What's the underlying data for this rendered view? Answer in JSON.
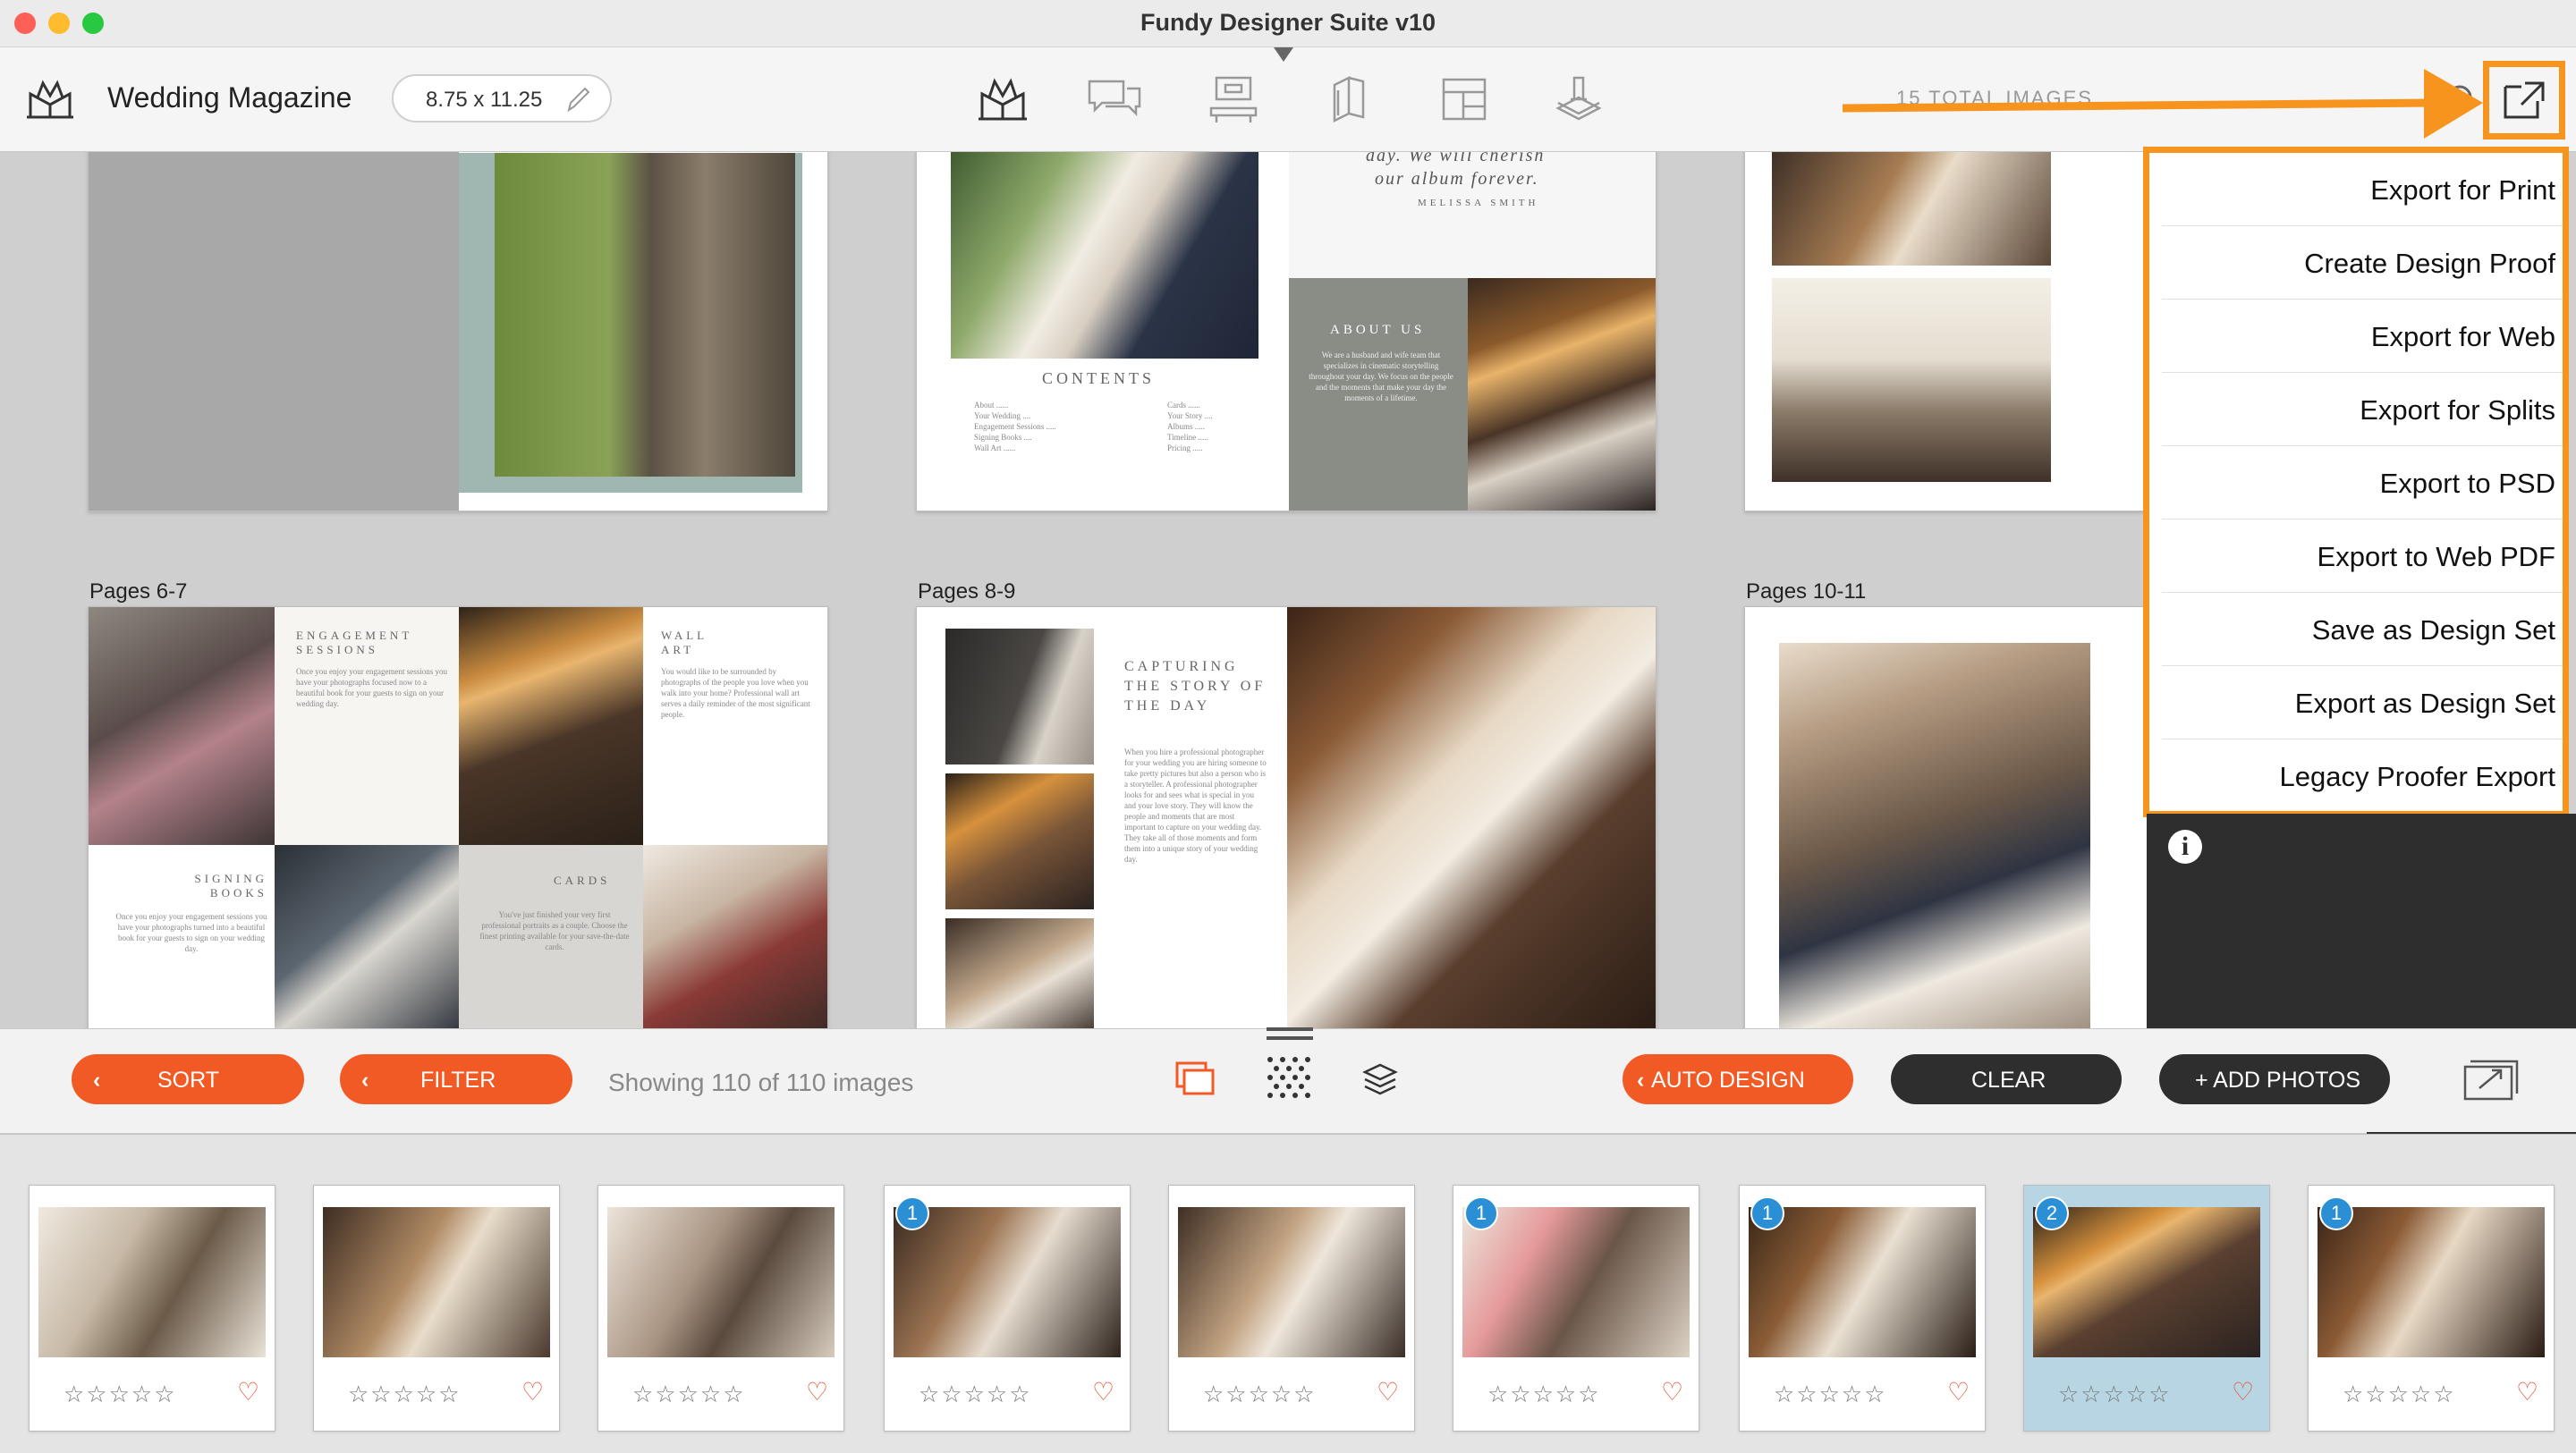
{
  "window": {
    "title": "Fundy Designer Suite v10"
  },
  "toolbar": {
    "project_name": "Wedding Magazine",
    "page_size": "8.75 x 11.25",
    "total_images": "15 TOTAL IMAGES",
    "tools": [
      "album-design-icon",
      "proof-chat-icon",
      "wall-art-icon",
      "cards-icon",
      "layout-icon",
      "print-stack-icon"
    ]
  },
  "spreads": [
    {
      "label": ""
    },
    {
      "label": ""
    },
    {
      "label": ""
    },
    {
      "label": "Pages 6-7"
    },
    {
      "label": "Pages 8-9"
    },
    {
      "label": "Pages 10-11"
    }
  ],
  "page_text": {
    "quote_1": "day. We will cherish",
    "quote_2": "our album forever.",
    "quote_author": "MELISSA SMITH",
    "contents": "CONTENTS",
    "about_us": "ABOUT US",
    "engagement": "ENGAGEMENT SESSIONS",
    "wall_art": "WALL ART",
    "signing_books": "SIGNING BOOKS",
    "cards": "CARDS",
    "capturing": "CAPTURING THE STORY OF THE DAY"
  },
  "export_menu": {
    "items": [
      "Export for Print",
      "Create Design Proof",
      "Export for Web",
      "Export for Splits",
      "Export to PSD",
      "Export to Web PDF",
      "Save as Design Set",
      "Export as Design Set",
      "Legacy Proofer Export"
    ]
  },
  "bottombar": {
    "sort_label": "SORT",
    "filter_label": "FILTER",
    "showing": "Showing 110 of 110 images",
    "auto_design_label": "AUTO DESIGN",
    "clear_label": "CLEAR",
    "add_photos_label": "+ ADD PHOTOS"
  },
  "thumbnails": [
    {
      "badge": "",
      "stars": "☆☆☆☆☆",
      "heart": "♡",
      "selected": false
    },
    {
      "badge": "",
      "stars": "☆☆☆☆☆",
      "heart": "♡",
      "selected": false
    },
    {
      "badge": "",
      "stars": "☆☆☆☆☆",
      "heart": "♡",
      "selected": false
    },
    {
      "badge": "1",
      "stars": "☆☆☆☆☆",
      "heart": "♡",
      "selected": false
    },
    {
      "badge": "",
      "stars": "☆☆☆☆☆",
      "heart": "♡",
      "selected": false
    },
    {
      "badge": "1",
      "stars": "☆☆☆☆☆",
      "heart": "♡",
      "selected": false
    },
    {
      "badge": "1",
      "stars": "☆☆☆☆☆",
      "heart": "♡",
      "selected": false
    },
    {
      "badge": "2",
      "stars": "☆☆☆☆☆",
      "heart": "♡",
      "selected": true
    },
    {
      "badge": "1",
      "stars": "☆☆☆☆☆",
      "heart": "♡",
      "selected": false
    }
  ],
  "colors": {
    "accent": "#f7941d",
    "button_orange": "#f15a24",
    "button_dark": "#2e2e2e",
    "badge_blue": "#2a8fd4"
  }
}
